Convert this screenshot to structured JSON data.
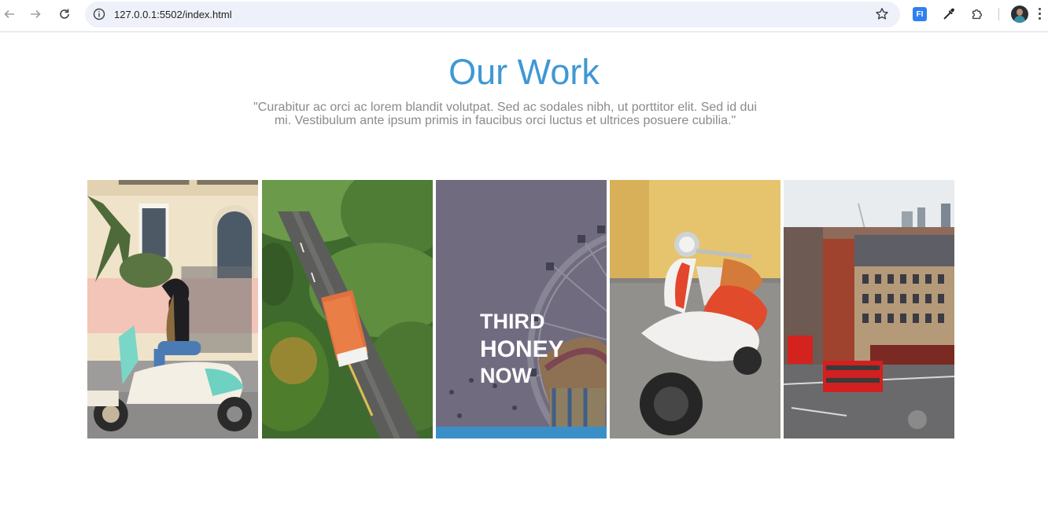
{
  "browser": {
    "url": "127.0.0.1:5502/index.html",
    "extension_label": "FI",
    "icons": [
      "back-arrow-icon",
      "forward-arrow-icon",
      "reload-icon",
      "site-info-icon",
      "bookmark-star-icon",
      "fi-extension-icon",
      "eyedropper-icon",
      "extensions-puzzle-icon",
      "profile-avatar",
      "more-menu-icon"
    ]
  },
  "page": {
    "title": "Our Work",
    "subtitle": "\"Curabitur ac orci ac lorem blandit volutpat. Sed ac sodales nibh, ut porttitor elit. Sed id dui mi. Vestibulum ante ipsum primis in faucibus orci luctus et ultrices posuere cubilia.\"",
    "accent_color": "#3f98d4"
  },
  "gallery": {
    "tiles": [
      {
        "subject": "woman-on-scooter-photo"
      },
      {
        "subject": "bus-on-road-photo"
      },
      {
        "subject": "ferris-wheel-photo",
        "caption": [
          "THIRD",
          "HONEY",
          "NOW"
        ],
        "hovered": true
      },
      {
        "subject": "vespa-scooter-photo"
      },
      {
        "subject": "london-street-photo"
      }
    ]
  }
}
